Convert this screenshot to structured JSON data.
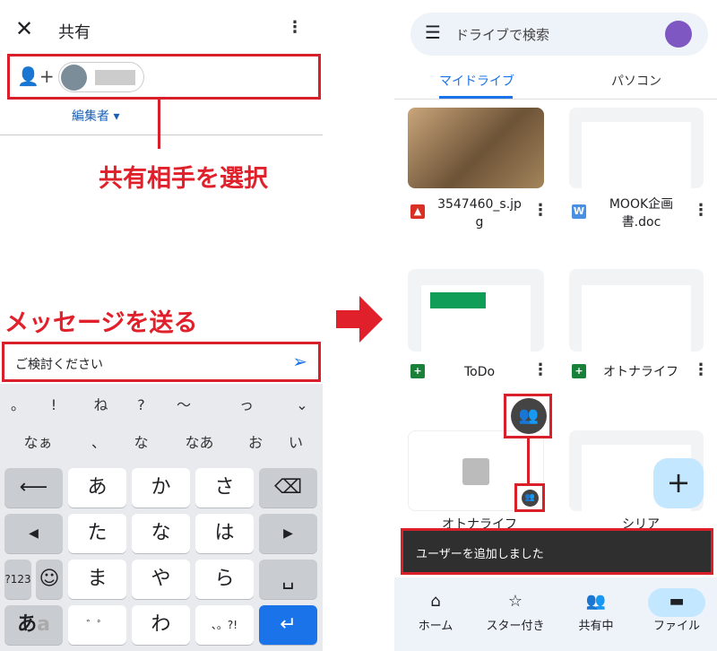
{
  "share": {
    "title": "共有",
    "role": "編集者",
    "message": "ご検討ください"
  },
  "annotations": {
    "select": "共有相手を選択",
    "send": "メッセージを送る"
  },
  "keyboard": {
    "suggest1": [
      "。",
      "!",
      "ね",
      "?",
      "〜",
      "っ"
    ],
    "suggest2": [
      "なぁ",
      "、",
      "な",
      "なあ",
      "お",
      "い"
    ],
    "rows": [
      [
        "あ",
        "か",
        "さ"
      ],
      [
        "た",
        "な",
        "は"
      ],
      [
        "ま",
        "や",
        "ら"
      ],
      [
        "",
        "わ",
        ""
      ]
    ],
    "num": "?123",
    "kana": "あ",
    "kana2": "a"
  },
  "drive": {
    "search_placeholder": "ドライブで検索",
    "tabs": [
      "マイドライブ",
      "パソコン"
    ],
    "files": [
      {
        "name": "3547460_s.jpg",
        "type": "image"
      },
      {
        "name": "MOOK企画書.doc",
        "type": "word"
      },
      {
        "name": "ToDo",
        "type": "sheet"
      },
      {
        "name": "オトナライフ",
        "type": "sheet"
      },
      {
        "name": "オトナライフ",
        "type": "doc"
      },
      {
        "name": "シリア",
        "type": "sheet"
      }
    ],
    "snackbar": "ユーザーを追加しました",
    "nav": [
      "ホーム",
      "スター付き",
      "共有中",
      "ファイル"
    ],
    "word_icon": "W"
  },
  "colors": {
    "accent": "#1a73e8",
    "annotation": "#d9202a"
  }
}
